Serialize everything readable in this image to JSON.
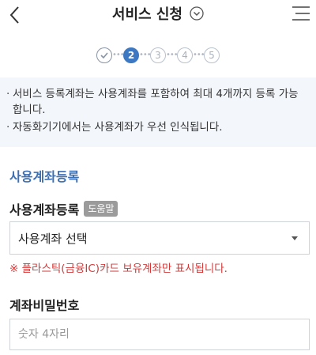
{
  "header": {
    "title": "서비스 신청"
  },
  "stepper": {
    "steps": [
      "1",
      "2",
      "3",
      "4",
      "5"
    ],
    "current": 2
  },
  "notice": {
    "lines": [
      "서비스 등록계좌는 사용계좌를 포함하여 최대 4개까지 등록 가능합니다.",
      "자동화기기에서는 사용계좌가 우선 인식됩니다."
    ]
  },
  "section": {
    "title": "사용계좌등록"
  },
  "account_field": {
    "label": "사용계좌등록",
    "help_badge": "도움말",
    "selected": "사용계좌 선택",
    "warning": "※ 플라스틱(금융IC)카드 보유계좌만 표시됩니다."
  },
  "password_field": {
    "label": "계좌비밀번호",
    "placeholder": "숫자 4자리"
  },
  "icons": {
    "back": "back-arrow-icon",
    "title_toggle": "chevron-down-circle-icon",
    "menu": "hamburger-menu-icon",
    "step_done": "check-icon"
  },
  "colors": {
    "accent": "#3d78c2",
    "section_title": "#3d6fb3",
    "warning": "#d23a3a",
    "notice_bg": "#f3f6fb"
  }
}
